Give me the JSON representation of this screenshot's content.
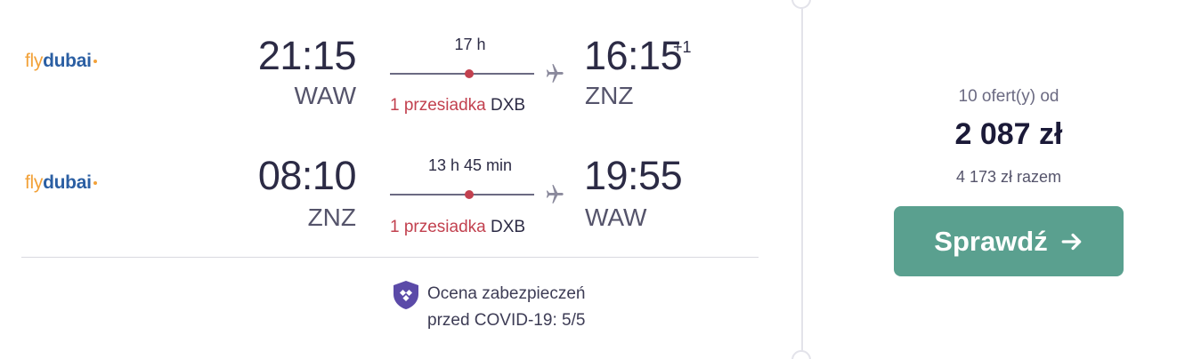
{
  "outbound": {
    "airline": {
      "part1": "fly",
      "part2": "dubai"
    },
    "depart_time": "21:15",
    "depart_airport": "WAW",
    "duration": "17 h",
    "stops_label": "1 przesiadka",
    "stop_airport": "DXB",
    "arrive_time": "16:15",
    "day_offset": "+1",
    "arrive_airport": "ZNZ"
  },
  "inbound": {
    "airline": {
      "part1": "fly",
      "part2": "dubai"
    },
    "depart_time": "08:10",
    "depart_airport": "ZNZ",
    "duration": "13 h 45 min",
    "stops_label": "1 przesiadka",
    "stop_airport": "DXB",
    "arrive_time": "19:55",
    "arrive_airport": "WAW"
  },
  "covid": {
    "line1": "Ocena zabezpieczeń",
    "line2": "przed COVID-19: 5/5",
    "icon": "shield-icon"
  },
  "price": {
    "offers_label": "10 ofert(y) od",
    "amount": "2 087 zł",
    "total": "4 173 zł razem"
  },
  "button": {
    "label": "Sprawdź",
    "icon": "arrow-right-icon"
  },
  "colors": {
    "accent_button": "#5aa08f",
    "stop_red": "#c2414f",
    "logo_orange": "#f2a23a",
    "logo_blue": "#2b5fa3"
  }
}
